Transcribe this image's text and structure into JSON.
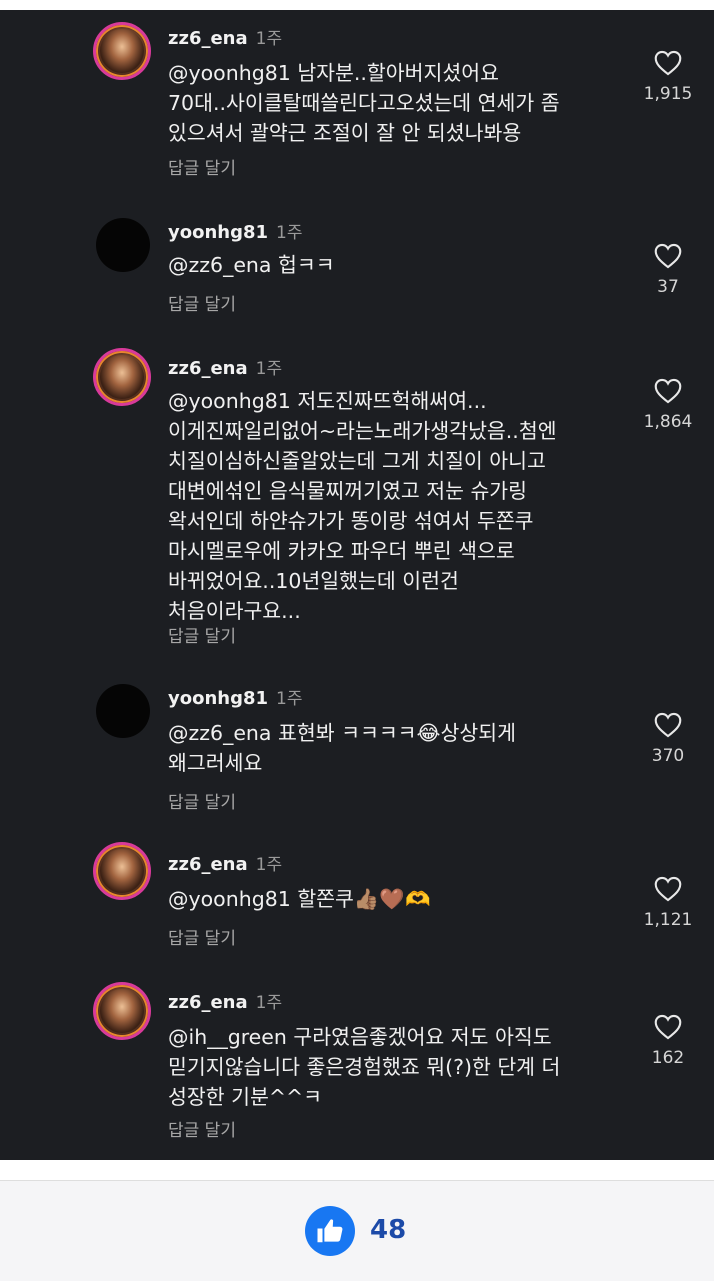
{
  "comments": [
    {
      "username": "zz6_ena",
      "time": "1주",
      "text": "@yoonhg81 남자분..할아버지셨어요\n70대..사이클탈때쓸린다고오셨는데 연세가 좀\n있으셔서 괄약근 조절이 잘 안 되셨나봐용",
      "reply_label": "답글 달기",
      "likes": "1,915",
      "avatar": "story"
    },
    {
      "username": "yoonhg81",
      "time": "1주",
      "text": "@zz6_ena 헙ㅋㅋ",
      "reply_label": "답글 달기",
      "likes": "37",
      "avatar": "plain"
    },
    {
      "username": "zz6_ena",
      "time": "1주",
      "text": "@yoonhg81 저도진짜뜨헉해써여...\n이게진짜일리없어~라는노래가생각났음..첨엔\n치질이심하신줄알았는데 그게 치질이 아니고\n대변에섞인 음식물찌꺼기였고 저눈 슈가링\n왁서인데 하얀슈가가 똥이랑 섞여서 두쫀쿠\n마시멜로우에 카카오 파우더 뿌린 색으로\n바뀌었어요..10년일했는데 이런건\n처음이라구요...",
      "reply_label": "답글 달기",
      "likes": "1,864",
      "avatar": "story"
    },
    {
      "username": "yoonhg81",
      "time": "1주",
      "text": "@zz6_ena 표현봐 ㅋㅋㅋㅋ😂상상되게\n왜그러세요",
      "reply_label": "답글 달기",
      "likes": "370",
      "avatar": "plain"
    },
    {
      "username": "zz6_ena",
      "time": "1주",
      "text": "@yoonhg81 할쫀쿠👍🏽🤎🫶",
      "reply_label": "답글 달기",
      "likes": "1,121",
      "avatar": "story"
    },
    {
      "username": "zz6_ena",
      "time": "1주",
      "text": "@ih__green 구라였음좋겠어요 저도 아직도\n믿기지않습니다 좋은경험했죠 뭐(?)한 단계 더\n성장한 기분^^ㅋ",
      "reply_label": "답글 달기",
      "likes": "162",
      "avatar": "story"
    }
  ],
  "footer": {
    "reaction_icon": "thumbs-up-icon",
    "reaction_count": "48",
    "accent": "#1877f2"
  }
}
